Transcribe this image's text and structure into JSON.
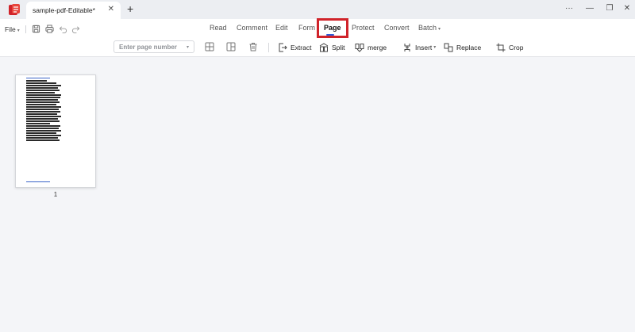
{
  "app": {
    "tab_title": "sample-pdf-Editable*",
    "tab_close": "✕",
    "new_tab": "+",
    "window_controls": {
      "more": "···",
      "minimize": "—",
      "restore": "❐",
      "close": "✕"
    },
    "brand_color": "#d0232a"
  },
  "menubar": {
    "file_label": "File",
    "quick_actions": [
      "save-icon",
      "print-icon",
      "undo-icon",
      "redo-icon"
    ],
    "nav": [
      {
        "label": "Read",
        "active": false
      },
      {
        "label": "Comment",
        "active": false
      },
      {
        "label": "Edit",
        "active": false
      },
      {
        "label": "Form",
        "active": false
      },
      {
        "label": "Page",
        "active": true
      },
      {
        "label": "Protect",
        "active": false
      },
      {
        "label": "Convert",
        "active": false
      },
      {
        "label": "Batch",
        "active": false,
        "dropdown": true
      }
    ],
    "accent_color": "#2f5bd8",
    "highlight_color": "#d0232a"
  },
  "toolbar": {
    "page_input_placeholder": "Enter page number",
    "page_input_value": "",
    "extract_label": "Extract",
    "split_label": "Split",
    "merge_label": "merge",
    "insert_label": "Insert",
    "replace_label": "Replace",
    "crop_label": "Crop"
  },
  "pages": [
    {
      "number": "1"
    }
  ]
}
